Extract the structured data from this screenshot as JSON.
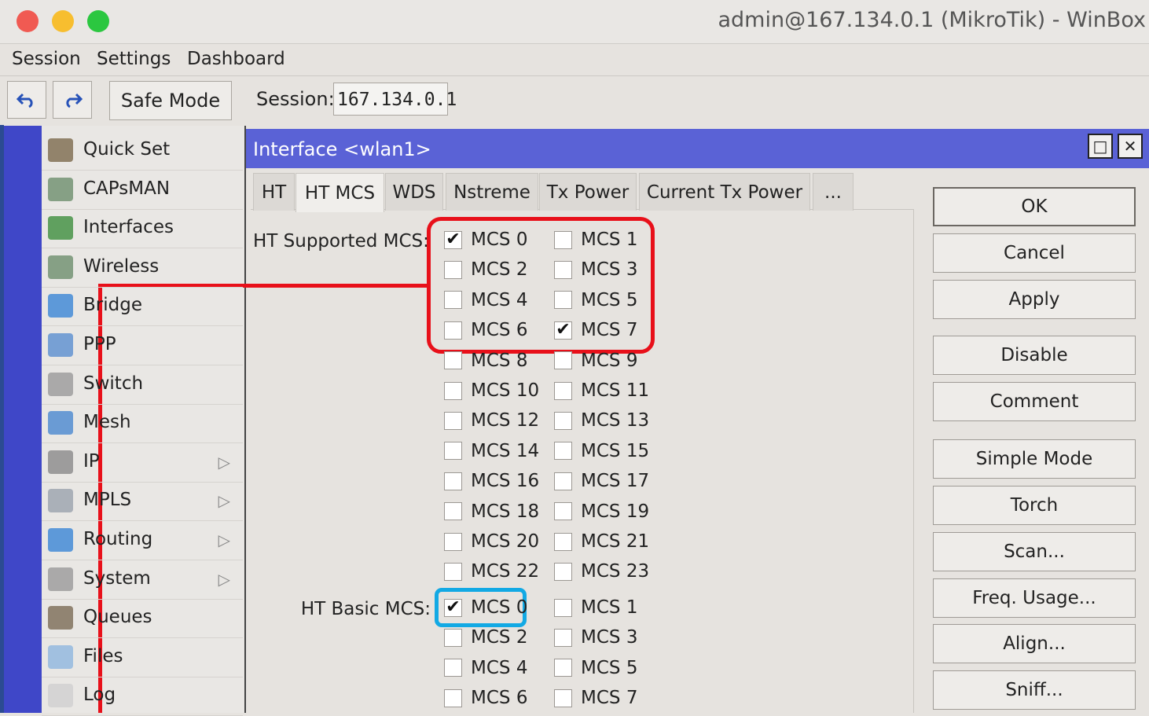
{
  "window": {
    "title": "admin@167.134.0.1 (MikroTik) - WinBox"
  },
  "menubar": {
    "items": [
      "Session",
      "Settings",
      "Dashboard"
    ]
  },
  "toolbar": {
    "safe_mode": "Safe Mode",
    "session_label": "Session:",
    "session_value": "167.134.0.1"
  },
  "sidebar": {
    "items": [
      {
        "label": "Quick Set",
        "icon": "quick-set-icon",
        "submenu": false
      },
      {
        "label": "CAPsMAN",
        "icon": "antenna-icon",
        "submenu": false
      },
      {
        "label": "Interfaces",
        "icon": "interfaces-icon",
        "submenu": false
      },
      {
        "label": "Wireless",
        "icon": "wireless-icon",
        "submenu": false
      },
      {
        "label": "Bridge",
        "icon": "bridge-icon",
        "submenu": false
      },
      {
        "label": "PPP",
        "icon": "ppp-icon",
        "submenu": false
      },
      {
        "label": "Switch",
        "icon": "switch-icon",
        "submenu": false
      },
      {
        "label": "Mesh",
        "icon": "mesh-icon",
        "submenu": false
      },
      {
        "label": "IP",
        "icon": "ip-icon",
        "submenu": true
      },
      {
        "label": "MPLS",
        "icon": "mpls-icon",
        "submenu": true
      },
      {
        "label": "Routing",
        "icon": "routing-icon",
        "submenu": true
      },
      {
        "label": "System",
        "icon": "system-gear-icon",
        "submenu": true
      },
      {
        "label": "Queues",
        "icon": "queues-icon",
        "submenu": false
      },
      {
        "label": "Files",
        "icon": "folder-icon",
        "submenu": false
      },
      {
        "label": "Log",
        "icon": "log-icon",
        "submenu": false
      }
    ]
  },
  "dialog": {
    "title": "Interface <wlan1>",
    "maximize_glyph": "□",
    "close_glyph": "✕",
    "tabs": [
      "HT",
      "HT MCS",
      "WDS",
      "Nstreme",
      "Tx Power",
      "Current Tx Power",
      "..."
    ],
    "active_tab": "HT MCS",
    "ht_supported_label": "HT Supported MCS:",
    "ht_basic_label": "HT Basic MCS:",
    "ht_supported": [
      {
        "label": "MCS 0",
        "checked": true
      },
      {
        "label": "MCS 1",
        "checked": false
      },
      {
        "label": "MCS 2",
        "checked": false
      },
      {
        "label": "MCS 3",
        "checked": false
      },
      {
        "label": "MCS 4",
        "checked": false
      },
      {
        "label": "MCS 5",
        "checked": false
      },
      {
        "label": "MCS 6",
        "checked": false
      },
      {
        "label": "MCS 7",
        "checked": true
      },
      {
        "label": "MCS 8",
        "checked": false
      },
      {
        "label": "MCS 9",
        "checked": false
      },
      {
        "label": "MCS 10",
        "checked": false
      },
      {
        "label": "MCS 11",
        "checked": false
      },
      {
        "label": "MCS 12",
        "checked": false
      },
      {
        "label": "MCS 13",
        "checked": false
      },
      {
        "label": "MCS 14",
        "checked": false
      },
      {
        "label": "MCS 15",
        "checked": false
      },
      {
        "label": "MCS 16",
        "checked": false
      },
      {
        "label": "MCS 17",
        "checked": false
      },
      {
        "label": "MCS 18",
        "checked": false
      },
      {
        "label": "MCS 19",
        "checked": false
      },
      {
        "label": "MCS 20",
        "checked": false
      },
      {
        "label": "MCS 21",
        "checked": false
      },
      {
        "label": "MCS 22",
        "checked": false
      },
      {
        "label": "MCS 23",
        "checked": false
      }
    ],
    "ht_basic": [
      {
        "label": "MCS 0",
        "checked": true
      },
      {
        "label": "MCS 1",
        "checked": false
      },
      {
        "label": "MCS 2",
        "checked": false
      },
      {
        "label": "MCS 3",
        "checked": false
      },
      {
        "label": "MCS 4",
        "checked": false
      },
      {
        "label": "MCS 5",
        "checked": false
      },
      {
        "label": "MCS 6",
        "checked": false
      },
      {
        "label": "MCS 7",
        "checked": false
      }
    ],
    "buttons": [
      "OK",
      "Cancel",
      "Apply",
      "Disable",
      "Comment",
      "Simple Mode",
      "Torch",
      "Scan...",
      "Freq. Usage...",
      "Align...",
      "Sniff..."
    ]
  },
  "annotations": {
    "highlight_colors": {
      "red": "#e8101a",
      "blue": "#12a9e4"
    }
  },
  "colors": {
    "dialog_title_bg": "#5a62d6",
    "sidebar_strip": "#3f47c8"
  }
}
